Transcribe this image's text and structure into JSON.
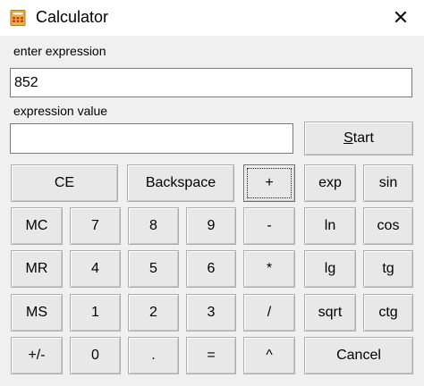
{
  "window": {
    "title": "Calculator",
    "close_glyph": "✕"
  },
  "input": {
    "label": "enter expression",
    "value": "852"
  },
  "output": {
    "label": "expression value",
    "value": ""
  },
  "start_button": {
    "label_underlined": "S",
    "label_rest": "tart"
  },
  "buttons": {
    "ce": "CE",
    "backspace": "Backspace",
    "plus": "+",
    "exp": "exp",
    "sin": "sin",
    "mc": "MC",
    "seven": "7",
    "eight": "8",
    "nine": "9",
    "minus": "-",
    "ln": "ln",
    "cos": "cos",
    "mr": "MR",
    "four": "4",
    "five": "5",
    "six": "6",
    "multiply": "*",
    "lg": "lg",
    "tg": "tg",
    "ms": "MS",
    "one": "1",
    "two": "2",
    "three": "3",
    "divide": "/",
    "sqrt": "sqrt",
    "ctg": "ctg",
    "plus_minus": "+/-",
    "zero": "0",
    "dot": ".",
    "equals": "=",
    "power": "^",
    "cancel": "Cancel"
  },
  "colors": {
    "window_bg": "#f0f0f0",
    "button_face": "#e8e8e8",
    "button_border": "#adadad"
  }
}
